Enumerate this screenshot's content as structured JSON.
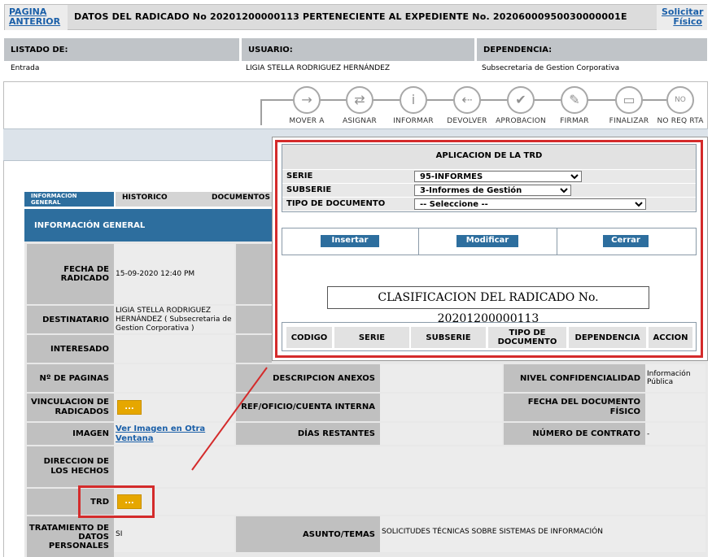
{
  "header": {
    "prev_link": "PAGINA ANTERIOR",
    "title": "DATOS DEL RADICADO No 20201200000113   PERTENECIENTE AL EXPEDIENTE No. 20206000950030000001E",
    "solicitar_link": "Solicitar Físico"
  },
  "info": {
    "listado_label": "LISTADO DE:",
    "usuario_label": "USUARIO:",
    "dependencia_label": "DEPENDENCIA:",
    "listado_value": "Entrada",
    "usuario_value": "LIGIA STELLA RODRIGUEZ HERNÁNDEZ",
    "dependencia_value": "Subsecretaria de Gestion Corporativa"
  },
  "workflow": [
    {
      "label": "MOVER A",
      "icon": "→"
    },
    {
      "label": "ASIGNAR",
      "icon": "⇄"
    },
    {
      "label": "INFORMAR",
      "icon": "i"
    },
    {
      "label": "DEVOLVER",
      "icon": "⇠"
    },
    {
      "label": "APROBACION",
      "icon": "✔"
    },
    {
      "label": "FIRMAR",
      "icon": "✎"
    },
    {
      "label": "FINALIZAR",
      "icon": "▭"
    },
    {
      "label": "NO REQ RTA",
      "icon": "NO"
    }
  ],
  "tabs": {
    "info_general": "INFORMACION GENERAL",
    "historico": "HISTORICO",
    "documentos": "DOCUMENTOS"
  },
  "section_title": "INFORMACIÓN GENERAL",
  "fields": {
    "fecha_label": "FECHA DE RADICADO",
    "fecha_value": "15-09-2020 12:40 PM",
    "destinatario_label": "DESTINATARIO",
    "destinatario_value": "LIGIA STELLA RODRIGUEZ HERNÁNDEZ ( Subsecretaria de Gestion Corporativa )",
    "interesado_label": "INTERESADO",
    "paginas_label": "Nº DE PAGINAS",
    "descripcion_label": "DESCRIPCION ANEXOS",
    "nivel_label": "NIVEL CONFIDENCIALIDAD",
    "nivel_value": "Información Pública",
    "vinculacion_label": "VINCULACION DE RADICADOS",
    "vinculacion_btn": "...",
    "ref_label": "REF/OFICIO/CUENTA INTERNA",
    "fecha_doc_label": "FECHA DEL DOCUMENTO FÍSICO",
    "imagen_label": "IMAGEN",
    "imagen_link": "Ver Imagen en Otra Ventana",
    "dias_label": "DÍAS RESTANTES",
    "contrato_label": "NÚMERO DE CONTRATO",
    "contrato_value": "-",
    "direccion_label": "DIRECCION DE LOS HECHOS",
    "trd_label": "TRD",
    "trd_btn": "...",
    "tratamiento_label": "TRATAMIENTO DE DATOS PERSONALES",
    "tratamiento_value": "SI",
    "asunto_label": "ASUNTO/TEMAS",
    "asunto_value": "SOLICITUDES TÉCNICAS SOBRE SISTEMAS DE INFORMACIÓN"
  },
  "popup": {
    "title": "APLICACION DE LA TRD",
    "serie_label": "SERIE",
    "serie_value": "95-INFORMES",
    "subserie_label": "SUBSERIE",
    "subserie_value": "3-Informes de Gestión",
    "tipo_label": "TIPO DE DOCUMENTO",
    "tipo_value": "-- Seleccione --",
    "insertar": "Insertar",
    "modificar": "Modificar",
    "cerrar": "Cerrar",
    "clasificacion": "CLASIFICACION DEL RADICADO No. 20201200000113",
    "columns": [
      "CODIGO",
      "SERIE",
      "SUBSERIE",
      "TIPO DE DOCUMENTO",
      "DEPENDENCIA",
      "ACCION"
    ]
  },
  "colors": {
    "accent": "#2d6e9e",
    "highlight": "#d42b2b",
    "button_yellow": "#e6a700"
  }
}
